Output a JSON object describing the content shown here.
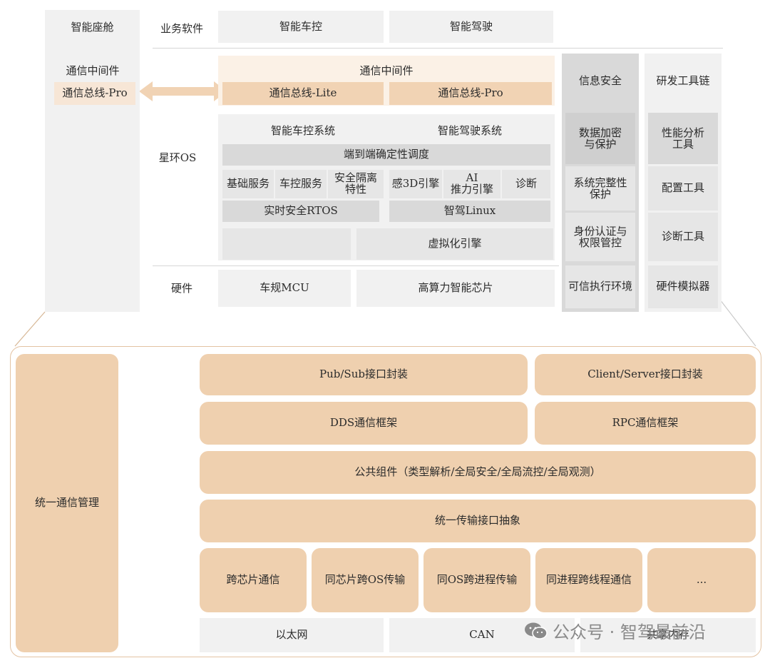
{
  "top": {
    "cockpit": "智能座舱",
    "software_label": "业务软件",
    "vehicle_control": "智能车控",
    "autonomous_driving": "智能驾驶",
    "left_middleware": "通信中间件",
    "left_bus_pro": "通信总线-Pro",
    "middleware": "通信中间件",
    "bus_lite": "通信总线-Lite",
    "bus_pro": "通信总线-Pro",
    "os_label": "星环OS",
    "vc_system": "智能车控系统",
    "ad_system": "智能驾驶系统",
    "scheduling": "端到端确定性调度",
    "basic_service": "基础服务",
    "vc_service": "车控服务",
    "safety_isolation": "安全隔离\n特性",
    "perception_3d": "感3D引擎",
    "ai_engine": "AI\n推力引擎",
    "diagnosis": "诊断",
    "rtos": "实时安全RTOS",
    "linux": "智驾Linux",
    "virtualization": "虚拟化引擎",
    "hardware_label": "硬件",
    "mcu": "车规MCU",
    "chip": "高算力智能芯片"
  },
  "security": {
    "title": "信息安全",
    "items": [
      "数据加密\n与保护",
      "系统完整性\n保护",
      "身份认证与\n权限管控",
      "可信执行环境"
    ]
  },
  "toolchain": {
    "title": "研发工具链",
    "items": [
      "性能分析\n工具",
      "配置工具",
      "诊断工具",
      "硬件模拟器"
    ]
  },
  "bottom": {
    "unified": "统一通信管理",
    "pubsub": "Pub/Sub接口封装",
    "clientserver": "Client/Server接口封装",
    "dds": "DDS通信框架",
    "rpc": "RPC通信框架",
    "common": "公共组件（类型解析/全局安全/全局流控/全局观测）",
    "transport": "统一传输接口抽象",
    "cross_chip": "跨芯片通信",
    "same_chip_os": "同芯片跨OS传输",
    "same_os_proc": "同OS跨进程传输",
    "same_proc_thread": "同进程跨线程通信",
    "more": "...",
    "ethernet": "以太网",
    "can": "CAN",
    "shared_mem": "共享内存"
  },
  "watermark": {
    "text": "公众号 · 智驾最前沿"
  }
}
